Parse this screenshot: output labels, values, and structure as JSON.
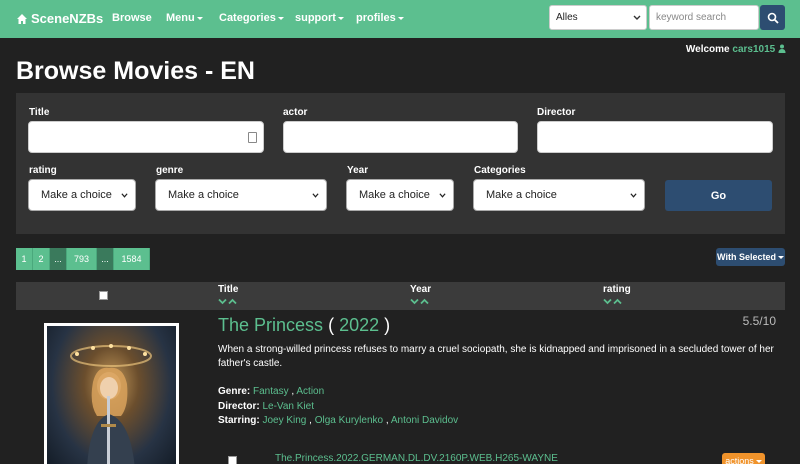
{
  "nav": {
    "brand": "SceneNZBs",
    "items": [
      {
        "label": "Browse",
        "dropdown": false
      },
      {
        "label": "Menu",
        "dropdown": true
      },
      {
        "label": "Categories",
        "dropdown": true
      },
      {
        "label": "support",
        "dropdown": true
      },
      {
        "label": "profiles",
        "dropdown": true
      }
    ],
    "search_select": "Alles",
    "search_placeholder": "keyword search"
  },
  "welcome": {
    "prefix": "Welcome ",
    "user": "cars1015"
  },
  "page_title": "Browse Movies - EN",
  "filters": {
    "title_label": "Title",
    "actor_label": "actor",
    "director_label": "Director",
    "rating_label": "rating",
    "genre_label": "genre",
    "year_label": "Year",
    "categories_label": "Categories",
    "placeholder_choice": "Make a choice",
    "go_label": "Go"
  },
  "pagination": [
    "1",
    "2",
    "...",
    "793",
    "...",
    "1584"
  ],
  "with_selected": "With Selected",
  "table_headers": {
    "title": "Title",
    "year": "Year",
    "rating": "rating"
  },
  "movie": {
    "title": "The Princess",
    "year": "2022",
    "rating": "5.5/10",
    "description": "When a strong-willed princess refuses to marry a cruel sociopath, she is kidnapped and imprisoned in a secluded tower of her father's castle.",
    "genre_label": "Genre:",
    "genres": [
      "Fantasy",
      "Action"
    ],
    "director_label": "Director:",
    "director": "Le-Van Kiet",
    "starring_label": "Starring:",
    "stars": [
      "Joey King",
      "Olga Kurylenko",
      "Antoni Davidov"
    ],
    "release": "The.Princess.2022.GERMAN.DL.DV.2160P.WEB.H265-WAYNE",
    "actions_label": "actions"
  },
  "colors": {
    "accent": "#5cbf8f",
    "button": "#2d4d71",
    "actions": "#f0932b",
    "background": "#212121",
    "panel": "#333333"
  }
}
